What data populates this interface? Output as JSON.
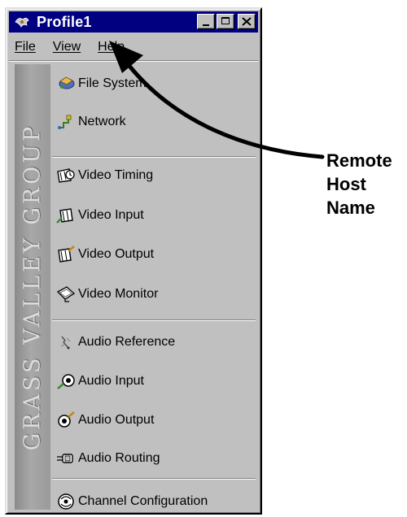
{
  "window": {
    "title": "Profile1",
    "controls": [
      "minimize-icon",
      "maximize-icon",
      "close-icon"
    ]
  },
  "menu": {
    "file": "File",
    "view": "View",
    "help": "Help"
  },
  "brand_strip": "GRASS VALLEY GROUP",
  "groups": [
    [
      {
        "label": "File System",
        "icon": "file-system-icon"
      },
      {
        "label": "Network",
        "icon": "network-icon"
      }
    ],
    [
      {
        "label": "Video Timing",
        "icon": "video-timing-icon"
      },
      {
        "label": "Video Input",
        "icon": "video-input-icon"
      },
      {
        "label": "Video Output",
        "icon": "video-output-icon"
      },
      {
        "label": "Video Monitor",
        "icon": "video-monitor-icon"
      }
    ],
    [
      {
        "label": "Audio Reference",
        "icon": "audio-reference-icon"
      },
      {
        "label": "Audio Input",
        "icon": "audio-input-icon"
      },
      {
        "label": "Audio Output",
        "icon": "audio-output-icon"
      },
      {
        "label": "Audio Routing",
        "icon": "audio-routing-icon"
      }
    ],
    [
      {
        "label": "Channel Configuration",
        "icon": "channel-configuration-icon"
      }
    ]
  ],
  "annotation": {
    "lines": [
      "Remote",
      "Host",
      "Name"
    ],
    "points_to": "window title"
  },
  "colors": {
    "titlebar": "#000080",
    "window_face": "#c0c0c0"
  }
}
